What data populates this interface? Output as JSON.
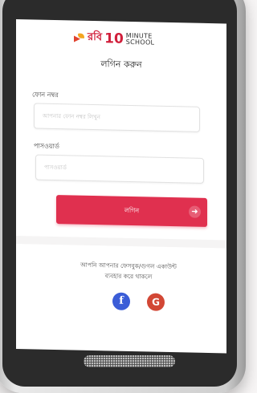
{
  "brand": {
    "name_bn": "রবি",
    "number": "10",
    "minute": "MINUTE",
    "school": "SCHOOL"
  },
  "login": {
    "title": "লগিন করুন",
    "phone_label": "ফোন নম্বর",
    "phone_placeholder": "আপনার ফোন নম্বর লিখুন",
    "password_label": "পাসওয়ার্ড",
    "password_placeholder": "পাসওয়ার্ড",
    "button_label": "লগিন",
    "button_icon": "arrow-right-icon"
  },
  "social": {
    "text_line1": "আপনি আপনার ফেসবুক/গুগল একাউন্ট",
    "text_line2": "ব্যবহার করে থাকলে",
    "facebook_glyph": "f",
    "google_glyph": "G",
    "facebook_color": "#3b5dd7",
    "google_color": "#d24735"
  },
  "colors": {
    "accent": "#e0304f",
    "brand": "#d11f3b"
  }
}
